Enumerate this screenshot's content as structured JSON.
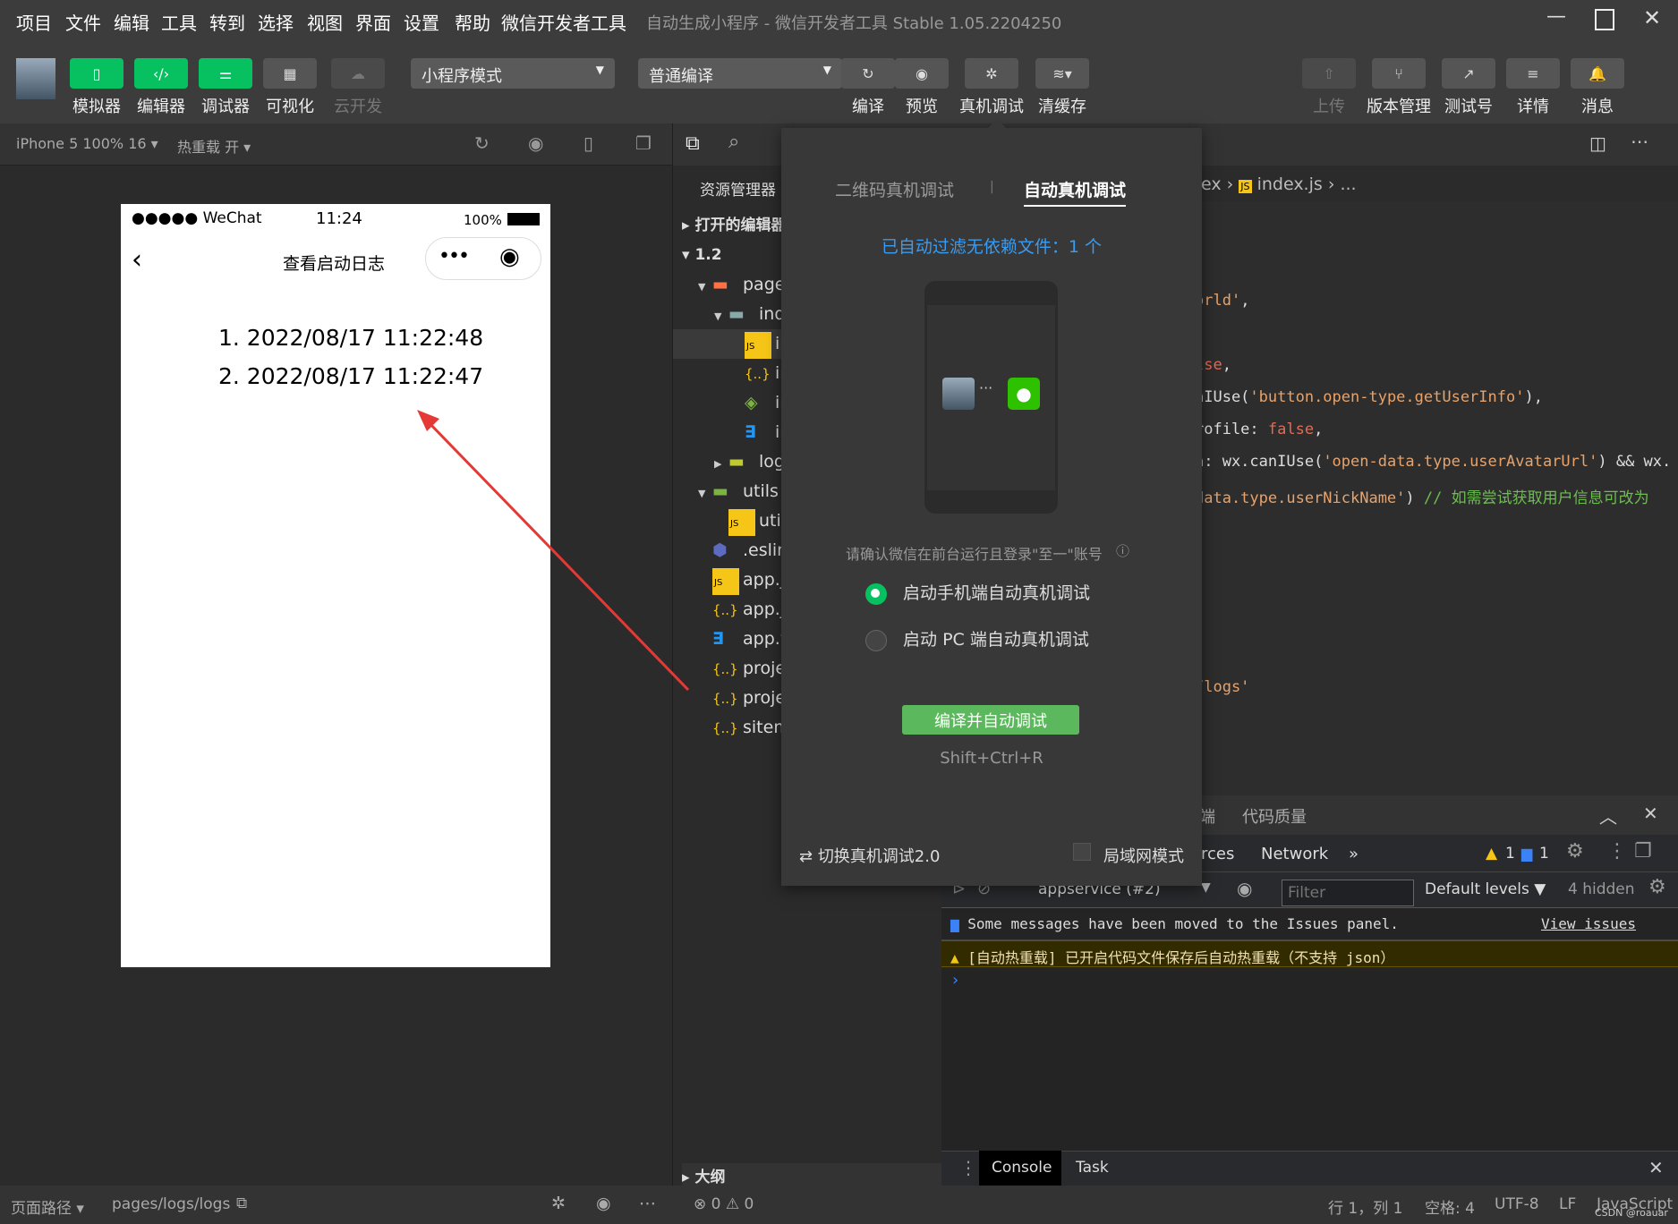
{
  "menu": [
    "项目",
    "文件",
    "编辑",
    "工具",
    "转到",
    "选择",
    "视图",
    "界面",
    "设置",
    "帮助",
    "微信开发者工具"
  ],
  "window_title": "自动生成小程序 - 微信开发者工具 Stable 1.05.2204250",
  "toolbar": {
    "left_buttons": [
      {
        "label": "模拟器",
        "icon": "phone-icon"
      },
      {
        "label": "编辑器",
        "icon": "code-icon"
      },
      {
        "label": "调试器",
        "icon": "debug-sliders-icon"
      },
      {
        "label": "可视化",
        "icon": "layout-icon"
      },
      {
        "label": "云开发",
        "icon": "cloud-icon"
      }
    ],
    "mode_select": "小程序模式",
    "compile_select": "普通编译",
    "mid_buttons": [
      {
        "label": "编译",
        "icon": "refresh-icon"
      },
      {
        "label": "预览",
        "icon": "eye-icon"
      },
      {
        "label": "真机调试",
        "icon": "bug-icon"
      },
      {
        "label": "清缓存",
        "icon": "layers-icon"
      }
    ],
    "right_buttons": [
      {
        "label": "上传",
        "icon": "upload-icon"
      },
      {
        "label": "版本管理",
        "icon": "branch-icon"
      },
      {
        "label": "测试号",
        "icon": "external-icon"
      },
      {
        "label": "详情",
        "icon": "menu-icon"
      },
      {
        "label": "消息",
        "icon": "bell-icon"
      }
    ]
  },
  "simbar": {
    "device": "iPhone 5 100% 16 ▾",
    "hot_reload": "热重载 开 ▾"
  },
  "phone": {
    "signal": "●●●●● WeChat",
    "time": "11:24",
    "battery": "100%",
    "page_title": "查看启动日志",
    "logs": [
      "1. 2022/08/17 11:22:48",
      "2. 2022/08/17 11:22:47"
    ]
  },
  "explorer": {
    "title": "资源管理器",
    "sections": [
      "打开的编辑器",
      "1.2"
    ],
    "items": [
      {
        "name": "pages",
        "icon": "folder-pages-icon",
        "indent": 1,
        "arrow": "▼"
      },
      {
        "name": "index",
        "icon": "folder-icon",
        "indent": 2,
        "arrow": "▼"
      },
      {
        "name": "index.js",
        "icon": "js-icon",
        "indent": 3,
        "arrow": ""
      },
      {
        "name": "index.json",
        "icon": "json-icon",
        "indent": 3,
        "arrow": ""
      },
      {
        "name": "index.wxml",
        "icon": "wxml-icon",
        "indent": 3,
        "arrow": ""
      },
      {
        "name": "index.wxss",
        "icon": "css-icon",
        "indent": 3,
        "arrow": ""
      },
      {
        "name": "logs",
        "icon": "folder-logs-icon",
        "indent": 2,
        "arrow": "▶"
      },
      {
        "name": "utils",
        "icon": "folder-utils-icon",
        "indent": 1,
        "arrow": "▼"
      },
      {
        "name": "util.js",
        "icon": "js-icon",
        "indent": 2,
        "arrow": ""
      },
      {
        "name": ".eslintrc.js",
        "icon": "eslint-icon",
        "indent": 1,
        "arrow": ""
      },
      {
        "name": "app.js",
        "icon": "js-icon",
        "indent": 1,
        "arrow": ""
      },
      {
        "name": "app.json",
        "icon": "json-icon",
        "indent": 1,
        "arrow": ""
      },
      {
        "name": "app.wxss",
        "icon": "css-icon",
        "indent": 1,
        "arrow": ""
      },
      {
        "name": "project.config.json",
        "icon": "json-icon",
        "indent": 1,
        "arrow": ""
      },
      {
        "name": "project.private.config.json",
        "icon": "json-icon",
        "indent": 1,
        "arrow": ""
      },
      {
        "name": "sitemap.json",
        "icon": "json-icon",
        "indent": 1,
        "arrow": ""
      }
    ],
    "outline": "大纲"
  },
  "editor": {
    "breadcrumb": [
      "ex",
      "index.js",
      "..."
    ],
    "code": [
      [
        {
          "t": "orld'",
          "c": "s"
        },
        {
          "t": ",",
          "c": ""
        }
      ],
      [
        {
          "t": "lse",
          "c": "k"
        },
        {
          "t": ",",
          "c": ""
        }
      ],
      [
        {
          "t": "nIUse(",
          "c": ""
        },
        {
          "t": "'button.open-type.getUserInfo'",
          "c": "s"
        },
        {
          "t": "),",
          "c": ""
        }
      ],
      [
        {
          "t": "rofile: ",
          "c": ""
        },
        {
          "t": "false",
          "c": "k"
        },
        {
          "t": ",",
          "c": ""
        }
      ],
      [
        {
          "t": "n: wx.",
          "c": ""
        },
        {
          "t": "canIUse(",
          "c": ""
        },
        {
          "t": "'open-data.type.userAvatarUrl'",
          "c": "s"
        },
        {
          "t": ") && wx.",
          "c": ""
        }
      ],
      [
        {
          "t": "data.type.userNickName'",
          "c": "s"
        },
        {
          "t": ") ",
          "c": ""
        },
        {
          "t": "// 如需尝试获取用户信息可改为",
          "c": "c"
        }
      ],
      [
        {
          "t": "/logs'",
          "c": "s"
        }
      ]
    ]
  },
  "popup": {
    "tabs": [
      "二维码真机调试",
      "自动真机调试"
    ],
    "active_tab": 1,
    "filtered": "已自动过滤无依赖文件：1 个",
    "notice": "请确认微信在前台运行且登录\"至一\"账号",
    "options": [
      "启动手机端自动真机调试",
      "启动 PC 端自动真机调试"
    ],
    "selected_option": 0,
    "primary_button": "编译并自动调试",
    "shortcut": "Shift+Ctrl+R",
    "switch": "切换真机调试2.0",
    "lan_mode": "局域网模式",
    "lan_checked": false
  },
  "devtools": {
    "top_tabs": [
      "端",
      "代码质量"
    ],
    "panel_tabs": [
      "rces",
      "Network",
      "»"
    ],
    "warn_count": "1",
    "info_count": "1",
    "context": "appservice (#2)",
    "filter_placeholder": "Filter",
    "levels": "Default levels ▼",
    "hidden": "4 hidden",
    "messages": [
      {
        "type": "info",
        "text": "Some messages have been moved to the Issues panel.",
        "link": "View issues"
      },
      {
        "type": "warning",
        "text": "[自动热重载] 已开启代码文件保存后自动热重载（不支持 json）"
      }
    ],
    "drawer_tabs": [
      "Console",
      "Task"
    ]
  },
  "statusbar": {
    "path_label": "页面路径 ▾",
    "path": "pages/logs/logs",
    "errors": "0",
    "warnings": "0",
    "position": "行 1，列 1",
    "spaces": "空格: 4",
    "encoding": "UTF-8",
    "eol": "LF",
    "language": "JavaScript",
    "watermark": "CSDN @roauar"
  }
}
